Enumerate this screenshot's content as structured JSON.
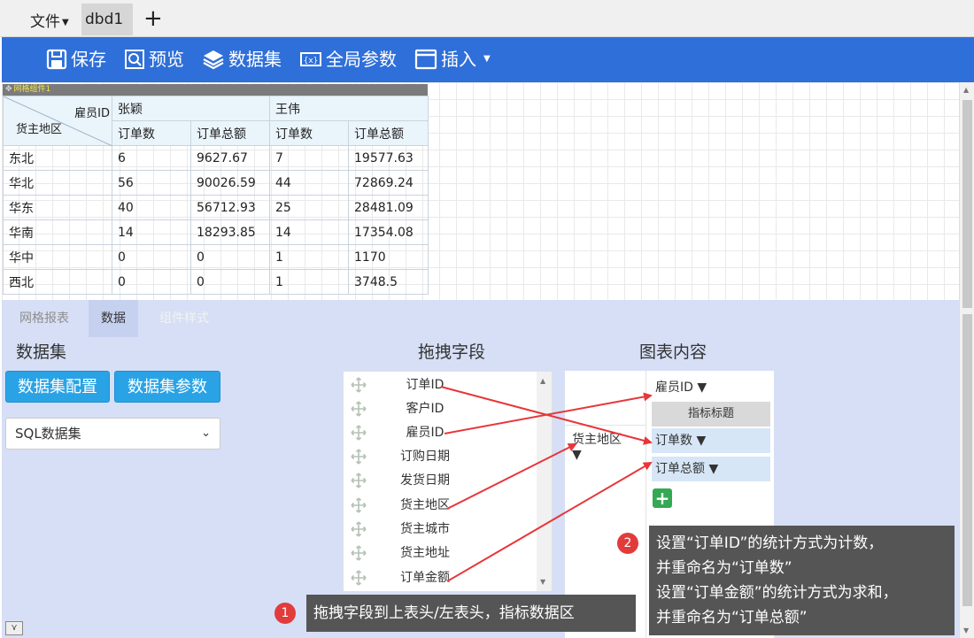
{
  "tabbar": {
    "file_menu": "文件",
    "doc_tab": "dbd1",
    "add_tab": "+"
  },
  "toolbar": {
    "save": "保存",
    "preview": "预览",
    "dataset": "数据集",
    "global_params": "全局参数",
    "insert": "插入"
  },
  "grid": {
    "component_label": "网格组件1",
    "corner_top": "雇员ID",
    "corner_bottom": "货主地区",
    "employees": [
      "张颖",
      "王伟"
    ],
    "metrics": [
      "订单数",
      "订单总额",
      "订单数",
      "订单总额"
    ],
    "rows": [
      [
        "东北",
        "6",
        "9627.67",
        "7",
        "19577.63"
      ],
      [
        "华北",
        "56",
        "90026.59",
        "44",
        "72869.24"
      ],
      [
        "华东",
        "40",
        "56712.93",
        "25",
        "28481.09"
      ],
      [
        "华南",
        "14",
        "18293.85",
        "14",
        "17354.08"
      ],
      [
        "华中",
        "0",
        "0",
        "1",
        "1170"
      ],
      [
        "西北",
        "0",
        "0",
        "1",
        "3748.5"
      ]
    ]
  },
  "panel": {
    "tabs": [
      "网格报表",
      "数据",
      "组件样式"
    ],
    "dataset_title": "数据集",
    "drag_title": "拖拽字段",
    "chart_title": "图表内容",
    "btn_config": "数据集配置",
    "btn_params": "数据集参数",
    "dataset_select": "SQL数据集",
    "fields": [
      "订单ID",
      "客户ID",
      "雇员ID",
      "订购日期",
      "发货日期",
      "货主地区",
      "货主城市",
      "货主地址",
      "订单金额"
    ],
    "chart": {
      "top_header": "雇员ID",
      "metric_title": "指标标题",
      "left_header": "货主地区",
      "metric_1": "订单数",
      "metric_2": "订单总额"
    }
  },
  "annotations": {
    "badge_1": "1",
    "callout_1": "拖拽字段到上表头/左表头，指标数据区",
    "badge_2": "2",
    "callout_2": [
      "设置“订单ID”的统计方式为计数，",
      "并重命名为“订单数”",
      "设置“订单金额”的统计方式为求和，",
      "并重命名为“订单总额”"
    ]
  },
  "colors": {
    "toolbar": "#2f6fd9",
    "panel": "#d6dff5",
    "button": "#2aa3e6",
    "arrow": "#e8363a",
    "callout": "#555555",
    "add": "#35a853"
  }
}
